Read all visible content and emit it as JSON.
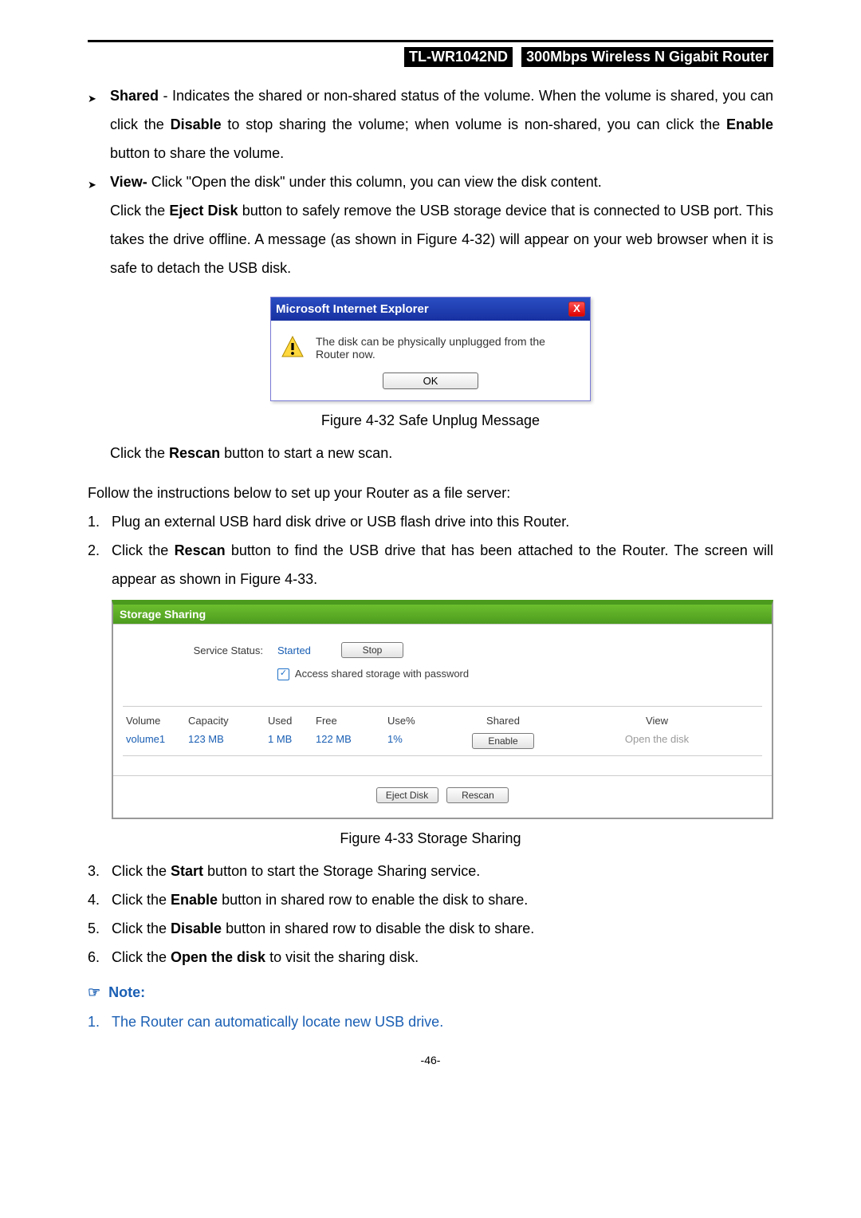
{
  "header": {
    "model": "TL-WR1042ND",
    "desc": "300Mbps Wireless N Gigabit Router"
  },
  "bullets": {
    "shared": {
      "title": "Shared",
      "sep": " - ",
      "rest_a": "Indicates the shared or non-shared status of the volume. When the volume is shared, you can click the ",
      "disable": "Disable",
      "rest_b": " to stop sharing the volume; when volume is non-shared, you can click the ",
      "enable": "Enable",
      "rest_c": " button to share the volume."
    },
    "view": {
      "title": "View-",
      "rest": " Click \"Open the disk\" under this column, you can view the disk content."
    },
    "eject": {
      "a": "Click the ",
      "b": "Eject Disk",
      "c": " button to safely remove the USB storage device that is connected to USB port. This takes the drive offline. A message (as shown in Figure 4-32) will appear on your web browser when it is safe to detach the USB disk."
    },
    "rescan": {
      "a": "Click the ",
      "b": "Rescan",
      "c": " button to start a new scan."
    }
  },
  "dialog": {
    "title": "Microsoft Internet Explorer",
    "close": "X",
    "msg": "The disk can be physically unplugged from the Router now.",
    "ok": "OK"
  },
  "fig32": "Figure 4-32 Safe Unplug Message",
  "fig33": "Figure 4-33 Storage Sharing",
  "instructions_intro": "Follow the instructions below to set up your Router as a file server:",
  "steps": {
    "s1": {
      "n": "1.",
      "t": "Plug an external USB hard disk drive or USB flash drive into this Router."
    },
    "s2": {
      "n": "2.",
      "a": "Click the ",
      "b": "Rescan",
      "c": " button to find the USB drive that has been attached to the Router. The screen will appear as shown in Figure 4-33."
    },
    "s3": {
      "n": "3.",
      "a": "Click the ",
      "b": "Start",
      "c": " button to start the Storage Sharing service."
    },
    "s4": {
      "n": "4.",
      "a": "Click the ",
      "b": "Enable",
      "c": " button in shared row to enable the disk to share."
    },
    "s5": {
      "n": "5.",
      "a": "Click the ",
      "b": "Disable",
      "c": " button in shared row to disable the disk to share."
    },
    "s6": {
      "n": "6.",
      "a": "Click the ",
      "b": "Open the disk",
      "c": " to visit the sharing disk."
    }
  },
  "panel": {
    "title": "Storage Sharing",
    "svc_label": "Service Status:",
    "svc_status": "Started",
    "stop_btn": "Stop",
    "chk_label": "Access shared storage with password",
    "hdr": {
      "volume": "Volume",
      "capacity": "Capacity",
      "used": "Used",
      "free": "Free",
      "usep": "Use%",
      "shared": "Shared",
      "view": "View"
    },
    "row": {
      "volume": "volume1",
      "capacity": "123 MB",
      "used": "1 MB",
      "free": "122 MB",
      "usep": "1%",
      "shared_btn": "Enable",
      "view_link": "Open the disk"
    },
    "eject_btn": "Eject Disk",
    "rescan_btn": "Rescan"
  },
  "note": {
    "label": "Note:",
    "n1_num": "1.",
    "n1_text": "The Router can automatically locate new USB drive."
  },
  "page_num": "-46-"
}
